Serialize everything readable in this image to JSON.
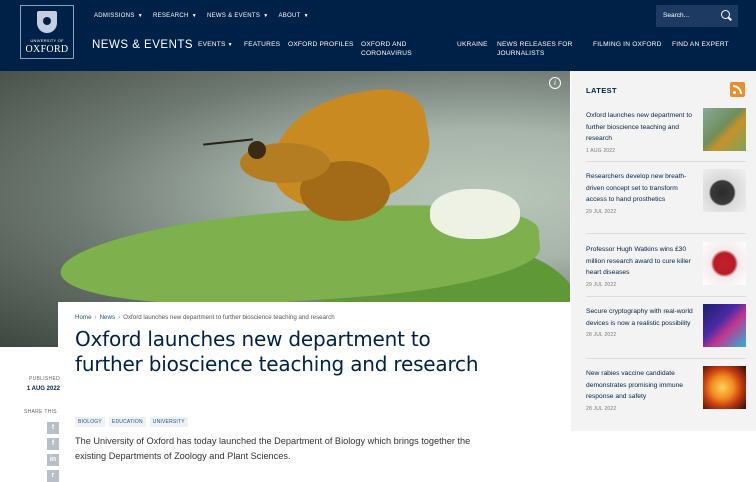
{
  "logo": {
    "line1": "UNIVERSITY OF",
    "line2": "OXFORD"
  },
  "top_nav": [
    {
      "label": "ADMISSIONS"
    },
    {
      "label": "RESEARCH"
    },
    {
      "label": "NEWS & EVENTS"
    },
    {
      "label": "ABOUT"
    }
  ],
  "search": {
    "placeholder": "Search..."
  },
  "section": {
    "title": "NEWS & EVENTS"
  },
  "sub_nav": [
    {
      "label": "EVENTS"
    },
    {
      "label": "FEATURES"
    },
    {
      "label": "OXFORD PROFILES"
    },
    {
      "label": "OXFORD AND CORONAVIRUS"
    },
    {
      "label": "UKRAINE"
    },
    {
      "label": "NEWS RELEASES FOR JOURNALISTS"
    },
    {
      "label": "FILMING IN OXFORD"
    },
    {
      "label": "FIND AN EXPERT"
    }
  ],
  "article": {
    "breadcrumb": [
      "Home",
      "News",
      "Oxford launches new department to further bioscience teaching and research"
    ],
    "title": "Oxford launches new department to further bioscience teaching and research",
    "published_label": "PUBLISHED",
    "published_date": "1 AUG 2022",
    "share_label": "SHARE THIS",
    "tags": [
      "BIOLOGY",
      "EDUCATION",
      "UNIVERSITY"
    ],
    "lede": "The University of Oxford has today launched the Department of Biology which brings together the existing Departments of Zoology and Plant Sciences."
  },
  "latest": {
    "title": "LATEST",
    "items": [
      {
        "title": "Oxford launches new department to further bioscience teaching and research",
        "date": "1 AUG 2022"
      },
      {
        "title": "Researchers develop new breath-driven concept set to transform access to hand prosthetics",
        "date": "29 JUL 2022"
      },
      {
        "title": "Professor Hugh Watkins wins £30 million research award to cure killer heart diseases",
        "date": "29 JUL 2022"
      },
      {
        "title": "Secure cryptography with real-world devices is now a realistic possibility",
        "date": "28 JUL 2022"
      },
      {
        "title": "New rabies vaccine candidate demonstrates promising immune response and safety",
        "date": "28 JUL 2022"
      }
    ]
  }
}
